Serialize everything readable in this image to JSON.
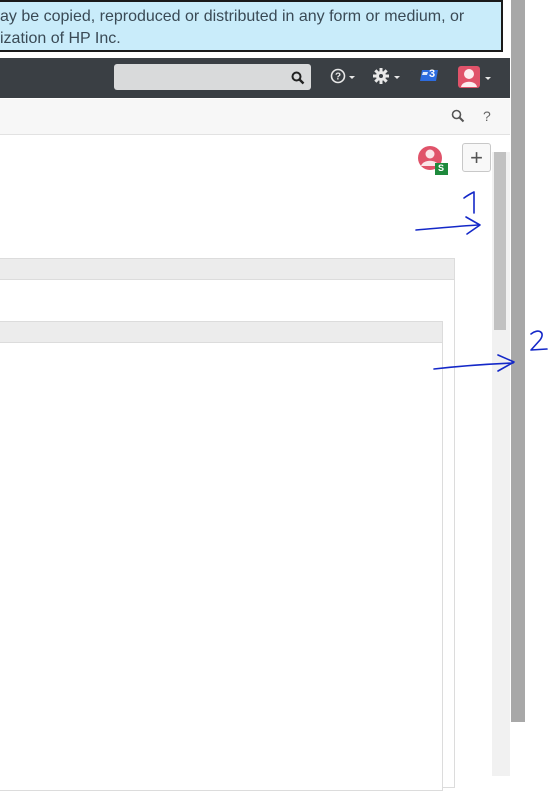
{
  "banner": {
    "line1": "ay be copied, reproduced or distributed in any form or medium, or",
    "line2": "ization of HP Inc."
  },
  "topbar": {
    "search_placeholder": "",
    "help_icon": "question-circle-icon",
    "settings_icon": "gear-icon",
    "notifications_count": "3",
    "notifications_icon": "notification-badge-icon",
    "avatar_icon": "user-avatar-icon"
  },
  "subbar": {
    "search_icon": "search-icon",
    "help_label": "?"
  },
  "main": {
    "avatar_badge": "S",
    "add_button_label": "+"
  },
  "annotations": {
    "label_1": "1",
    "label_2": "2"
  },
  "colors": {
    "banner_bg": "#c9ecfa",
    "topbar_bg": "#3a3f44",
    "badge_blue": "#2d6cdf",
    "avatar_red": "#e0536a",
    "avatar_badge_green": "#1e8a3c",
    "annotation_ink": "#1428c8"
  }
}
